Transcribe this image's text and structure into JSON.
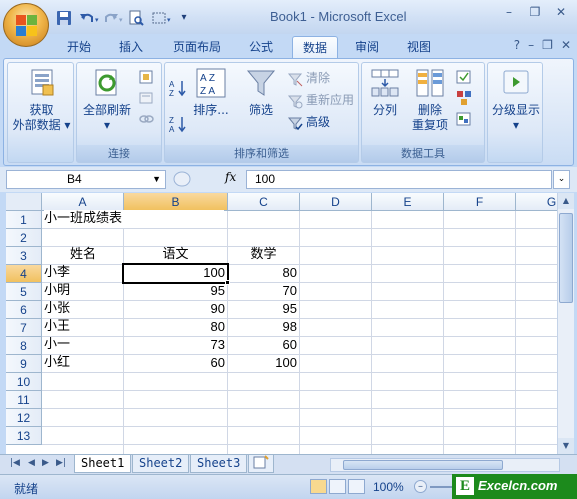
{
  "window": {
    "title": "Book1 - Microsoft Excel"
  },
  "qat": {
    "icons": [
      "save-icon",
      "undo-icon",
      "redo-icon",
      "print-preview-icon",
      "drawing-icon",
      "customize-icon"
    ]
  },
  "tabs": [
    {
      "label": "开始"
    },
    {
      "label": "插入"
    },
    {
      "label": "页面布局"
    },
    {
      "label": "公式"
    },
    {
      "label": "数据",
      "active": true
    },
    {
      "label": "审阅"
    },
    {
      "label": "视图"
    }
  ],
  "ribbon": {
    "get_external": {
      "line1": "获取",
      "line2": "外部数据"
    },
    "refresh_all": {
      "label": "全部刷新"
    },
    "connection_group": "连接",
    "sort": {
      "label": "排序..."
    },
    "filter": {
      "label": "筛选"
    },
    "clear": {
      "label": "清除"
    },
    "reapply": {
      "label": "重新应用"
    },
    "advanced": {
      "label": "高级"
    },
    "sort_filter_group": "排序和筛选",
    "text_to_columns": {
      "label": "分列"
    },
    "remove_duplicates": {
      "line1": "删除",
      "line2": "重复项"
    },
    "data_tools_group": "数据工具",
    "outline": {
      "label": "分级显示"
    }
  },
  "formula_bar": {
    "name_box": "B4",
    "fx": "fx",
    "value": "100"
  },
  "columns": [
    "A",
    "B",
    "C",
    "D",
    "E",
    "F",
    "G"
  ],
  "rows": [
    "1",
    "2",
    "3",
    "4",
    "5",
    "6",
    "7",
    "8",
    "9",
    "10",
    "11",
    "12",
    "13"
  ],
  "cells": {
    "a1": "小一班成绩表",
    "a3": "姓名",
    "b3": "语文",
    "c3": "数学",
    "a4": "小李",
    "b4": "100",
    "c4": "80",
    "a5": "小明",
    "b5": "95",
    "c5": "70",
    "a6": "小张",
    "b6": "90",
    "c6": "95",
    "a7": "小王",
    "b7": "80",
    "c7": "98",
    "a8": "小一",
    "b8": "73",
    "c8": "60",
    "a9": "小红",
    "b9": "60",
    "c9": "100"
  },
  "sheets": [
    {
      "label": "Sheet1",
      "active": true
    },
    {
      "label": "Sheet2"
    },
    {
      "label": "Sheet3"
    }
  ],
  "status": {
    "text": "就绪",
    "zoom": "100%"
  },
  "watermark": {
    "letter": "E",
    "text": "Excelcn.com"
  },
  "colors": {
    "accent": "#15428b",
    "selection": "#f1c15f",
    "ribbon": "#dbe7f7",
    "watermark": "#1c8a1c"
  }
}
